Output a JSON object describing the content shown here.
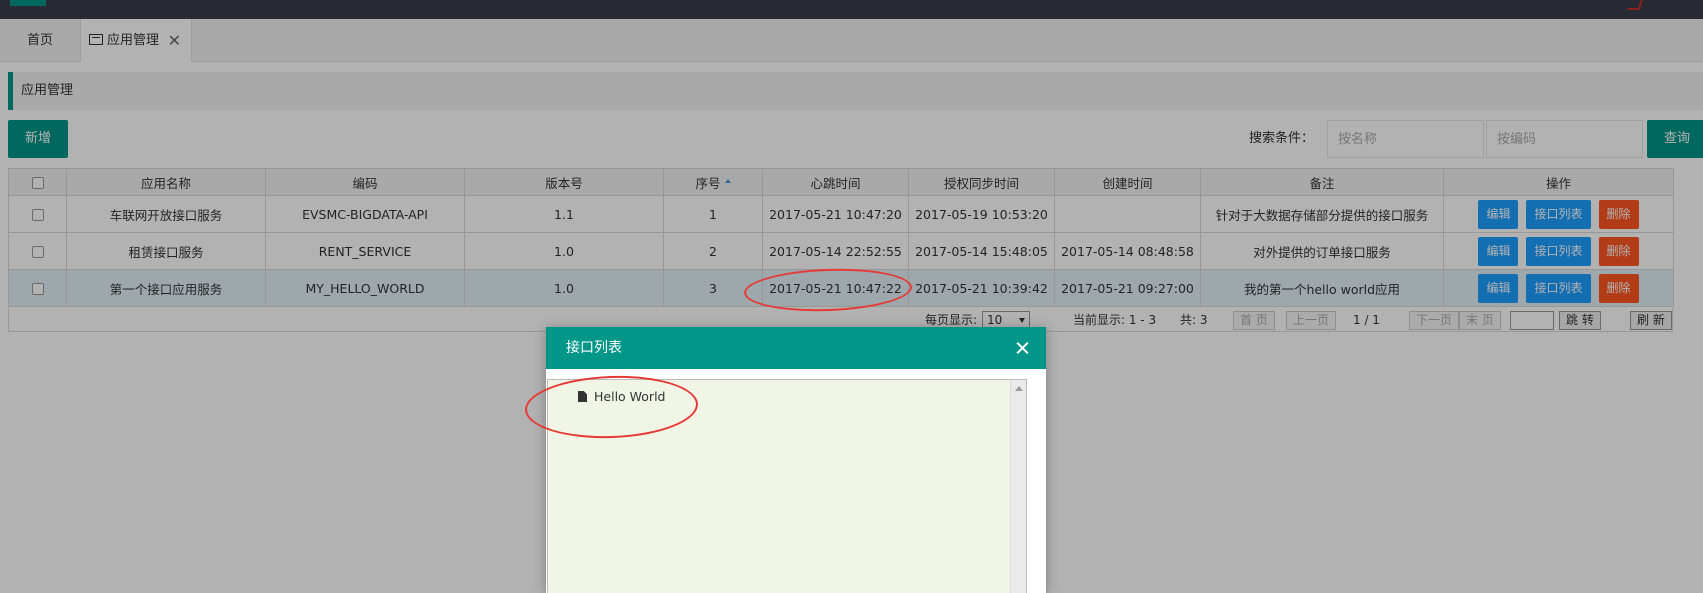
{
  "tabs": {
    "home": "首页",
    "app": "应用管理",
    "close": "✕"
  },
  "breadcrumb": "应用管理",
  "toolbar": {
    "add_label": "新增",
    "search_label": "搜索条件：",
    "name_placeholder": "按名称",
    "code_placeholder": "按编码",
    "query_label": "查询"
  },
  "table": {
    "columns": [
      "应用名称",
      "编码",
      "版本号",
      "序号",
      "心跳时间",
      "授权同步时间",
      "创建时间",
      "备注",
      "操作"
    ],
    "actions": {
      "edit": "编辑",
      "list": "接口列表",
      "delete": "删除"
    },
    "rows": [
      {
        "name": "车联网开放接口服务",
        "code": "EVSMC-BIGDATA-API",
        "version": "1.1",
        "seq": "1",
        "heartbeat": "2017-05-21 10:47:20",
        "sync": "2017-05-19 10:53:20",
        "created": "",
        "remark": "针对于大数据存储部分提供的接口服务"
      },
      {
        "name": "租赁接口服务",
        "code": "RENT_SERVICE",
        "version": "1.0",
        "seq": "2",
        "heartbeat": "2017-05-14 22:52:55",
        "sync": "2017-05-14 15:48:05",
        "created": "2017-05-14 08:48:58",
        "remark": "对外提供的订单接口服务"
      },
      {
        "name": "第一个接口应用服务",
        "code": "MY_HELLO_WORLD",
        "version": "1.0",
        "seq": "3",
        "heartbeat": "2017-05-21 10:47:22",
        "sync": "2017-05-21 10:39:42",
        "created": "2017-05-21 09:27:00",
        "remark": "我的第一个hello world应用"
      }
    ]
  },
  "pager": {
    "size_label": "每页显示:",
    "size_value": "10",
    "current": "当前显示: 1 - 3",
    "total": "共: 3",
    "first": "首 页",
    "prev": "上一页",
    "page_info": "1 / 1",
    "next": "下一页",
    "last": "末 页",
    "jump": "跳 转",
    "refresh": "刷 新"
  },
  "dialog": {
    "title": "接口列表",
    "node": "Hello World"
  },
  "colors": {
    "teal": "#009688",
    "blue": "#1e9fff",
    "red": "#ff5722",
    "annotation": "#e53935"
  }
}
